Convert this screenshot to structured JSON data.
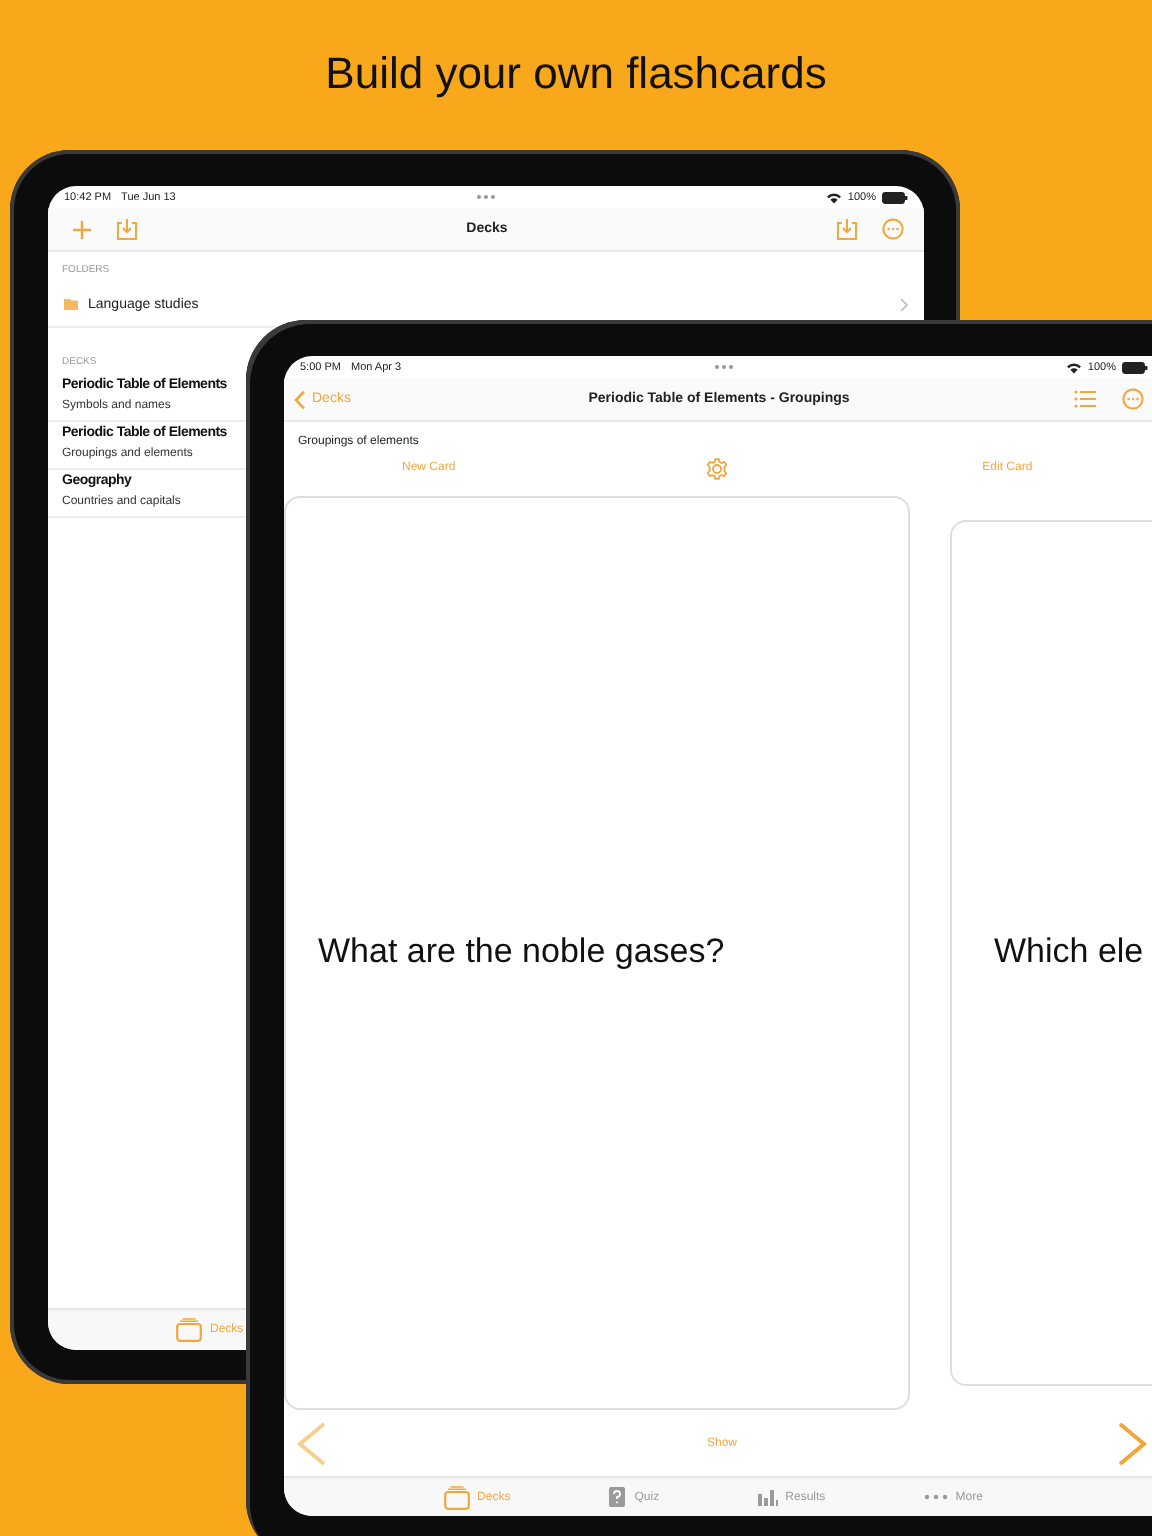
{
  "headline": "Build your own flashcards",
  "back_device": {
    "status_bar": {
      "time": "10:42 PM",
      "date": "Tue Jun 13",
      "battery": "100%"
    },
    "nav": {
      "title": "Decks"
    },
    "folders_header": "FOLDERS",
    "folders": [
      {
        "name": "Language studies"
      }
    ],
    "decks_header": "DECKS",
    "decks": [
      {
        "title": "Periodic Table of Elements",
        "subtitle": "Symbols and names"
      },
      {
        "title": "Periodic Table of Elements",
        "subtitle": "Groupings and elements"
      },
      {
        "title": "Geography",
        "subtitle": "Countries and capitals"
      }
    ],
    "tabs": [
      {
        "label": "Decks",
        "kind": "decks",
        "selected": true
      }
    ]
  },
  "front_device": {
    "status_bar": {
      "time": "5:00 PM",
      "date": "Mon Apr 3",
      "battery": "100%"
    },
    "nav": {
      "back": "Decks",
      "title": "Periodic Table of Elements - Groupings"
    },
    "description": "Groupings of elements",
    "actions": {
      "new": "New Card",
      "edit": "Edit Card"
    },
    "cards": [
      {
        "question": "What are the noble gases?"
      },
      {
        "question": "Which ele"
      }
    ],
    "show": "Show",
    "tabs": [
      {
        "label": "Decks",
        "kind": "decks",
        "selected": true
      },
      {
        "label": "Quiz",
        "kind": "quiz",
        "selected": false
      },
      {
        "label": "Results",
        "kind": "results",
        "selected": false
      },
      {
        "label": "More",
        "kind": "more",
        "selected": false
      }
    ]
  }
}
